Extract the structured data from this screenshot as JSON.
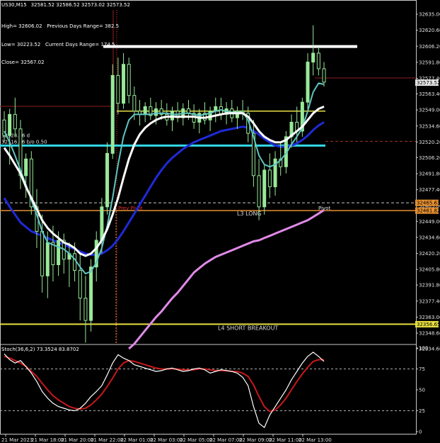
{
  "header": {
    "symbol": "US30,M15",
    "ohlc": "32581.52 32586.52 32573.02 32573.52"
  },
  "info_panel": {
    "high": "High= 32606.02",
    "prev_range": "Previous Days Range= 382.5",
    "low": "Low= 30223.52",
    "curr_range": "Current Days Range= 174.5",
    "close": "Close= 32567.02"
  },
  "stoch_label": "Stoch(36,6,2) 73.3524 83.8702",
  "colors": {
    "background": "#000000",
    "candle": "#98e898",
    "white_ma": "#ffffff",
    "teal_ma": "#5fc6c2",
    "blue_ma": "#1f2ad8",
    "violet_ma": "#e08ae8",
    "yellow_level": "#e8e040",
    "cyan_level": "#32d8e8",
    "orange_level": "#e89030",
    "red_text": "#e83030",
    "stoch_main": "#ffffff",
    "stoch_signal": "#c81818"
  },
  "chart_data": {
    "type": "candlestick",
    "symbol": "US30",
    "timeframe": "M15",
    "ylim": [
      32334.6,
      32635.0
    ],
    "y_ticks": [
      32635.0,
      32620.6,
      32606.2,
      32591.8,
      32577.4,
      32563.4,
      32549.0,
      32534.6,
      32520.2,
      32506.2,
      32491.8,
      32477.4,
      32463.0,
      32449.0,
      32434.6,
      32420.2,
      32405.8,
      32391.8,
      32377.4,
      32363.0,
      32348.6,
      32334.6
    ],
    "y_tick_labels": [
      "32635.00",
      "32620.60",
      "32606.20",
      "32591.80",
      "32577.40",
      "32563.40",
      "32549.00",
      "32534.60",
      "32520.20",
      "32506.20",
      "32491.80",
      "32477.40",
      "32463.00",
      "32449.00",
      "32434.60",
      "32420.20",
      "32405.80",
      "32391.80",
      "32377.40",
      "32363.00",
      "32348.60",
      "32334.60"
    ],
    "x_ticks": [
      "21 Mar 2023",
      "21 Mar 18:00",
      "21 Mar 20:00",
      "21 Mar 22:00",
      "22 Mar 01:00",
      "22 Mar 03:00",
      "22 Mar 05:00",
      "22 Mar 07:00",
      "22 Mar 09:00",
      "22 Mar 11:00",
      "22 Mar 13:00"
    ],
    "current_price": "32573.52",
    "price_tags": [
      "32465.63",
      "32461.82",
      "32356.65"
    ],
    "levels": [
      {
        "price": 32606.0,
        "color": "#ffffff",
        "label": ""
      },
      {
        "price": 32548.0,
        "color": "#e8e040",
        "label": ""
      },
      {
        "price": 32517.0,
        "color": "#32d8e8",
        "label": ""
      },
      {
        "price": 32465.6,
        "color": "#e89030",
        "label": "L3 LONG"
      },
      {
        "price": 32461.8,
        "color": "#e89030",
        "label": ""
      },
      {
        "price": 32356.6,
        "color": "#e8e040",
        "label": "L4 SHORT BREAKOUT"
      }
    ],
    "annotations": [
      "L3 LONG",
      "L4 SHORT BREAKOUT",
      "Pivot",
      "Prev Pivot"
    ],
    "cyan_notes": [
      "32528.36 d",
      "32516.36 b/o 0.50"
    ],
    "candles": [
      {
        "o": 32540,
        "h": 32548,
        "l": 32520,
        "c": 32526
      },
      {
        "o": 32526,
        "h": 32550,
        "l": 32500,
        "c": 32545
      },
      {
        "o": 32545,
        "h": 32560,
        "l": 32525,
        "c": 32532
      },
      {
        "o": 32532,
        "h": 32540,
        "l": 32478,
        "c": 32490
      },
      {
        "o": 32490,
        "h": 32510,
        "l": 32470,
        "c": 32505
      },
      {
        "o": 32505,
        "h": 32512,
        "l": 32455,
        "c": 32462
      },
      {
        "o": 32462,
        "h": 32478,
        "l": 32425,
        "c": 32440
      },
      {
        "o": 32440,
        "h": 32455,
        "l": 32385,
        "c": 32400
      },
      {
        "o": 32400,
        "h": 32440,
        "l": 32380,
        "c": 32430
      },
      {
        "o": 32430,
        "h": 32445,
        "l": 32395,
        "c": 32410
      },
      {
        "o": 32410,
        "h": 32440,
        "l": 32400,
        "c": 32432
      },
      {
        "o": 32432,
        "h": 32438,
        "l": 32402,
        "c": 32415
      },
      {
        "o": 32415,
        "h": 32430,
        "l": 32390,
        "c": 32420
      },
      {
        "o": 32420,
        "h": 32430,
        "l": 32395,
        "c": 32405
      },
      {
        "o": 32405,
        "h": 32420,
        "l": 32360,
        "c": 32380
      },
      {
        "o": 32380,
        "h": 32400,
        "l": 32340,
        "c": 32360
      },
      {
        "o": 32360,
        "h": 32415,
        "l": 32350,
        "c": 32408
      },
      {
        "o": 32408,
        "h": 32440,
        "l": 32395,
        "c": 32432
      },
      {
        "o": 32432,
        "h": 32470,
        "l": 32420,
        "c": 32462
      },
      {
        "o": 32462,
        "h": 32520,
        "l": 32455,
        "c": 32510
      },
      {
        "o": 32510,
        "h": 32590,
        "l": 32505,
        "c": 32580
      },
      {
        "o": 32580,
        "h": 32596,
        "l": 32545,
        "c": 32555
      },
      {
        "o": 32555,
        "h": 32600,
        "l": 32550,
        "c": 32590
      },
      {
        "o": 32590,
        "h": 32596,
        "l": 32555,
        "c": 32562
      },
      {
        "o": 32562,
        "h": 32570,
        "l": 32540,
        "c": 32548
      },
      {
        "o": 32548,
        "h": 32558,
        "l": 32535,
        "c": 32545
      },
      {
        "o": 32545,
        "h": 32556,
        "l": 32538,
        "c": 32552
      },
      {
        "o": 32552,
        "h": 32560,
        "l": 32540,
        "c": 32544
      },
      {
        "o": 32544,
        "h": 32556,
        "l": 32536,
        "c": 32550
      },
      {
        "o": 32550,
        "h": 32558,
        "l": 32540,
        "c": 32545
      },
      {
        "o": 32545,
        "h": 32555,
        "l": 32535,
        "c": 32540
      },
      {
        "o": 32540,
        "h": 32552,
        "l": 32530,
        "c": 32548
      },
      {
        "o": 32548,
        "h": 32556,
        "l": 32538,
        "c": 32542
      },
      {
        "o": 32542,
        "h": 32555,
        "l": 32535,
        "c": 32550
      },
      {
        "o": 32550,
        "h": 32558,
        "l": 32540,
        "c": 32546
      },
      {
        "o": 32546,
        "h": 32554,
        "l": 32532,
        "c": 32538
      },
      {
        "o": 32538,
        "h": 32550,
        "l": 32528,
        "c": 32546
      },
      {
        "o": 32546,
        "h": 32556,
        "l": 32536,
        "c": 32540
      },
      {
        "o": 32540,
        "h": 32552,
        "l": 32530,
        "c": 32548
      },
      {
        "o": 32548,
        "h": 32560,
        "l": 32538,
        "c": 32552
      },
      {
        "o": 32552,
        "h": 32560,
        "l": 32540,
        "c": 32545
      },
      {
        "o": 32545,
        "h": 32556,
        "l": 32536,
        "c": 32550
      },
      {
        "o": 32550,
        "h": 32558,
        "l": 32538,
        "c": 32542
      },
      {
        "o": 32542,
        "h": 32552,
        "l": 32532,
        "c": 32548
      },
      {
        "o": 32548,
        "h": 32558,
        "l": 32540,
        "c": 32546
      },
      {
        "o": 32546,
        "h": 32552,
        "l": 32520,
        "c": 32528
      },
      {
        "o": 32528,
        "h": 32540,
        "l": 32480,
        "c": 32490
      },
      {
        "o": 32490,
        "h": 32505,
        "l": 32450,
        "c": 32462
      },
      {
        "o": 32462,
        "h": 32500,
        "l": 32455,
        "c": 32495
      },
      {
        "o": 32495,
        "h": 32510,
        "l": 32470,
        "c": 32480
      },
      {
        "o": 32480,
        "h": 32512,
        "l": 32472,
        "c": 32505
      },
      {
        "o": 32505,
        "h": 32520,
        "l": 32490,
        "c": 32498
      },
      {
        "o": 32498,
        "h": 32530,
        "l": 32492,
        "c": 32525
      },
      {
        "o": 32525,
        "h": 32545,
        "l": 32515,
        "c": 32538
      },
      {
        "o": 32538,
        "h": 32552,
        "l": 32520,
        "c": 32530
      },
      {
        "o": 32530,
        "h": 32560,
        "l": 32525,
        "c": 32556
      },
      {
        "o": 32556,
        "h": 32600,
        "l": 32550,
        "c": 32592
      },
      {
        "o": 32592,
        "h": 32625,
        "l": 32580,
        "c": 32600
      },
      {
        "o": 32600,
        "h": 32606,
        "l": 32580,
        "c": 32586
      },
      {
        "o": 32586,
        "h": 32592,
        "l": 32570,
        "c": 32574
      }
    ],
    "white_ma": [
      32515,
      32508,
      32500,
      32492,
      32480,
      32470,
      32460,
      32450,
      32443,
      32438,
      32434,
      32430,
      32428,
      32425,
      32420,
      32418,
      32420,
      32425,
      32432,
      32442,
      32455,
      32470,
      32488,
      32505,
      32518,
      32527,
      32533,
      32537,
      32540,
      32542,
      32543,
      32543,
      32543,
      32543,
      32543,
      32543,
      32542,
      32542,
      32543,
      32544,
      32545,
      32546,
      32546,
      32546,
      32546,
      32543,
      32537,
      32530,
      32525,
      32522,
      32520,
      32520,
      32522,
      32526,
      32530,
      32534,
      32540,
      32546,
      32550,
      32552
    ],
    "teal_ma": [
      32530,
      32520,
      32508,
      32495,
      32482,
      32468,
      32455,
      32440,
      32430,
      32428,
      32426,
      32424,
      32420,
      32415,
      32408,
      32402,
      32404,
      32412,
      32425,
      32445,
      32470,
      32500,
      32525,
      32540,
      32545,
      32545,
      32545,
      32545,
      32546,
      32546,
      32546,
      32545,
      32545,
      32546,
      32546,
      32545,
      32544,
      32545,
      32546,
      32548,
      32549,
      32548,
      32547,
      32547,
      32547,
      32540,
      32525,
      32508,
      32500,
      32498,
      32500,
      32504,
      32510,
      32518,
      32525,
      32533,
      32548,
      32565,
      32573,
      32572
    ],
    "blue_ma": [
      32470,
      32462,
      32455,
      32448,
      32444,
      32440,
      32438,
      32436,
      32434,
      32432,
      32430,
      32428,
      32426,
      32424,
      32422,
      32420,
      32419,
      32419,
      32420,
      32423,
      32427,
      32433,
      32440,
      32448,
      32456,
      32464,
      32472,
      32480,
      32488,
      32495,
      32501,
      32506,
      32510,
      32514,
      32517,
      32520,
      32522,
      32524,
      32526,
      32528,
      32530,
      32531,
      32532,
      32533,
      32534,
      32533,
      32530,
      32527,
      32523,
      32520,
      32517,
      32516,
      32516,
      32517,
      32519,
      32522,
      32526,
      32531,
      32535,
      32538
    ],
    "violet_ma": [
      null,
      null,
      null,
      null,
      null,
      null,
      null,
      null,
      null,
      null,
      null,
      null,
      null,
      null,
      null,
      null,
      null,
      null,
      null,
      null,
      null,
      null,
      null,
      32334.6,
      32339,
      32345,
      32351,
      32357,
      32363,
      32368,
      32374,
      32380,
      32385,
      32391,
      32397,
      32403,
      32407,
      32411,
      32414,
      32417,
      32419,
      32421,
      32423,
      32425,
      32427,
      32429,
      32431,
      32432,
      32434,
      32436,
      32438,
      32440,
      32442,
      32444,
      32446,
      32448,
      32450,
      32453,
      32456,
      32459
    ],
    "stoch_ylim": [
      0,
      100
    ],
    "stoch_ticks": [
      100,
      75,
      50,
      25,
      0
    ],
    "stoch_main": [
      93,
      86,
      82,
      85,
      78,
      70,
      60,
      48,
      40,
      34,
      30,
      28,
      26,
      25,
      28,
      34,
      42,
      48,
      55,
      68,
      82,
      92,
      88,
      85,
      80,
      78,
      76,
      74,
      72,
      73,
      75,
      76,
      74,
      72,
      73,
      75,
      76,
      74,
      70,
      72,
      74,
      73,
      72,
      70,
      65,
      55,
      30,
      10,
      5,
      20,
      30,
      40,
      50,
      62,
      72,
      82,
      90,
      95,
      90,
      84
    ],
    "stoch_signal": [
      90,
      88,
      85,
      82,
      78,
      72,
      66,
      58,
      50,
      43,
      38,
      34,
      30,
      28,
      27,
      28,
      32,
      38,
      45,
      54,
      64,
      75,
      82,
      85,
      84,
      82,
      80,
      78,
      76,
      75,
      75,
      75,
      75,
      74,
      74,
      74,
      75,
      75,
      74,
      73,
      73,
      73,
      72,
      72,
      70,
      66,
      56,
      42,
      30,
      24,
      26,
      32,
      40,
      50,
      60,
      69,
      77,
      84,
      86,
      86
    ]
  }
}
